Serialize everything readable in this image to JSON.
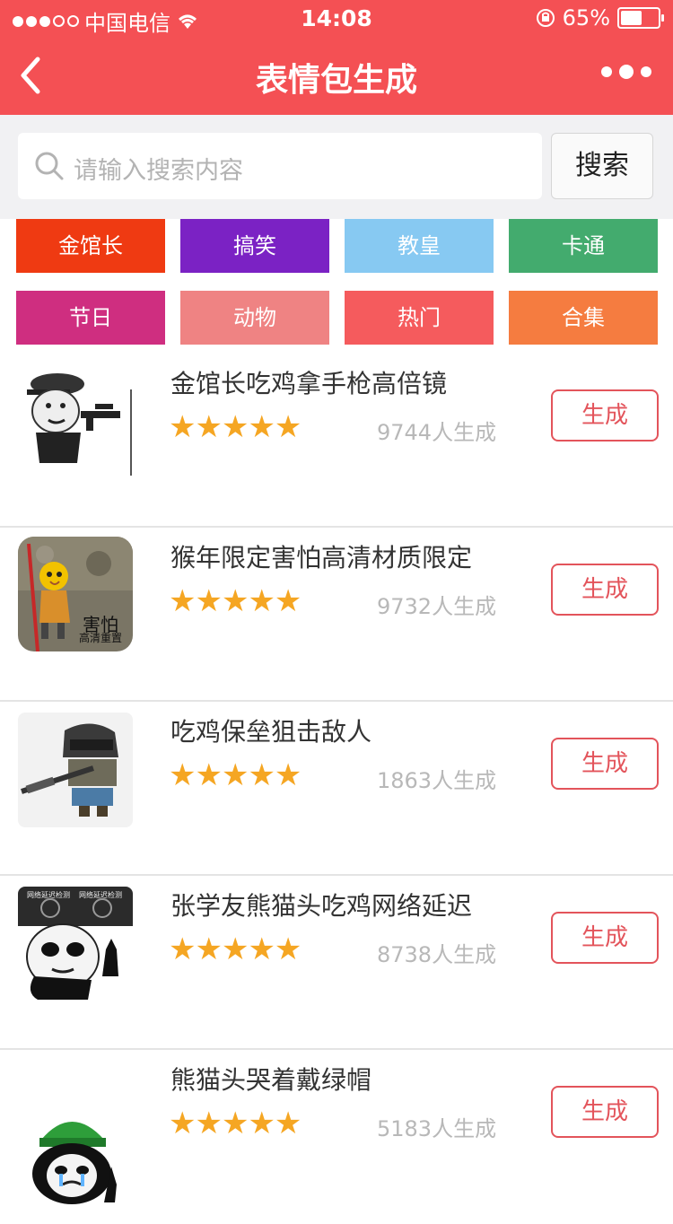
{
  "status_bar": {
    "carrier": "中国电信",
    "time": "14:08",
    "battery_percent": "65%",
    "battery_level": 0.65
  },
  "nav": {
    "title": "表情包生成",
    "back_icon": "chevron-left-icon",
    "more_icon": "more-dots-icon"
  },
  "search": {
    "placeholder": "请输入搜索内容",
    "button_label": "搜索"
  },
  "categories": [
    {
      "label": "金馆长",
      "color": "#ef3a12"
    },
    {
      "label": "搞笑",
      "color": "#7b22c4"
    },
    {
      "label": "教皇",
      "color": "#87c9f2"
    },
    {
      "label": "卡通",
      "color": "#43ab6e"
    },
    {
      "label": "节日",
      "color": "#cf2e80"
    },
    {
      "label": "动物",
      "color": "#ef8383"
    },
    {
      "label": "热门",
      "color": "#f55b5d"
    },
    {
      "label": "合集",
      "color": "#f57c40"
    }
  ],
  "items": [
    {
      "title": "金馆长吃鸡拿手枪高倍镜",
      "stars": "★★★★★",
      "rating": 5,
      "count": "9744人生成",
      "button": "生成",
      "thumb": "meme-gun-thumbnail"
    },
    {
      "title": "猴年限定害怕高清材质限定",
      "stars": "★★★★★",
      "rating": 5,
      "count": "9732人生成",
      "button": "生成",
      "thumb": "meme-monkey-thumbnail",
      "thumb_text": "害怕",
      "thumb_subtext": "高清重置"
    },
    {
      "title": "吃鸡保垒狙击敌人",
      "stars": "★★★★★",
      "rating": 5,
      "count": "1863人生成",
      "button": "生成",
      "thumb": "meme-helmet-rifle-thumbnail"
    },
    {
      "title": "张学友熊猫头吃鸡网络延迟",
      "stars": "★★★★★",
      "rating": 5,
      "count": "8738人生成",
      "button": "生成",
      "thumb": "meme-panda-network-thumbnail",
      "thumb_text_left": "网络延迟检测",
      "thumb_text_right": "网络延迟检测"
    },
    {
      "title": "熊猫头哭着戴绿帽",
      "stars": "★★★★★",
      "rating": 5,
      "count": "5183人生成",
      "button": "生成",
      "thumb": "meme-panda-greenhat-thumbnail"
    }
  ]
}
